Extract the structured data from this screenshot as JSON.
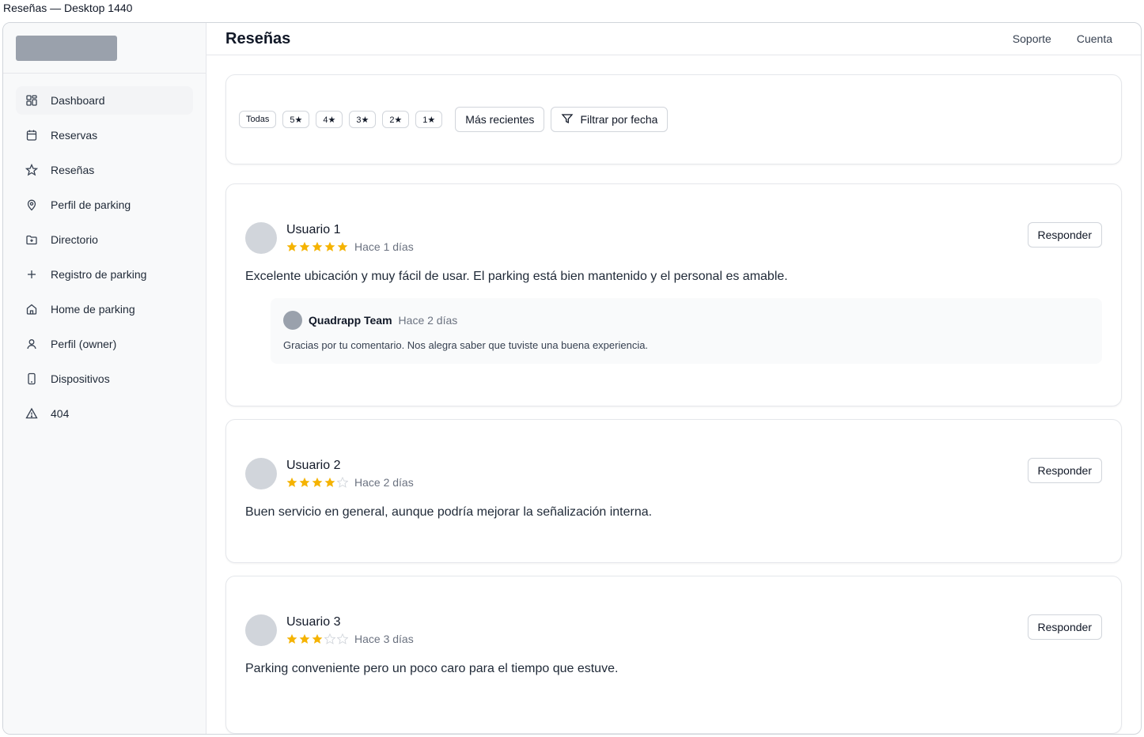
{
  "frame_label": "Reseñas — Desktop 1440",
  "sidebar": {
    "items": [
      {
        "label": "Dashboard",
        "icon": "dashboard-icon",
        "active": true
      },
      {
        "label": "Reservas",
        "icon": "calendar-icon"
      },
      {
        "label": "Reseñas",
        "icon": "star-icon"
      },
      {
        "label": "Perfil de parking",
        "icon": "map-pin-icon"
      },
      {
        "label": "Directorio",
        "icon": "folder-icon"
      },
      {
        "label": "Registro de parking",
        "icon": "plus-icon"
      },
      {
        "label": "Home de parking",
        "icon": "home-icon"
      },
      {
        "label": "Perfil (owner)",
        "icon": "user-icon"
      },
      {
        "label": "Dispositivos",
        "icon": "device-icon"
      },
      {
        "label": "404",
        "icon": "warning-icon"
      }
    ]
  },
  "header": {
    "title": "Reseñas",
    "links": [
      "Soporte",
      "Cuenta"
    ]
  },
  "filters": {
    "chips": [
      "Todas",
      "5★",
      "4★",
      "3★",
      "2★",
      "1★"
    ],
    "sort_label": "Más recientes",
    "date_filter_label": "Filtrar por fecha"
  },
  "colors": {
    "star_filled": "#f5b301",
    "star_empty": "#d1d5db",
    "avatar": "#d1d5db"
  },
  "reviews": [
    {
      "user": "Usuario 1",
      "rating": 5,
      "time": "Hace 1 días",
      "text": "Excelente ubicación y muy fácil de usar. El parking está bien mantenido y el personal es amable.",
      "reply_label": "Responder",
      "reply": {
        "author": "Quadrapp Team",
        "time": "Hace 2 días",
        "text": "Gracias por tu comentario. Nos alegra saber que tuviste una buena experiencia."
      }
    },
    {
      "user": "Usuario 2",
      "rating": 4,
      "time": "Hace 2 días",
      "text": "Buen servicio en general, aunque podría mejorar la señalización interna.",
      "reply_label": "Responder"
    },
    {
      "user": "Usuario 3",
      "rating": 3,
      "time": "Hace 3 días",
      "text": "Parking conveniente pero un poco caro para el tiempo que estuve.",
      "reply_label": "Responder"
    }
  ]
}
